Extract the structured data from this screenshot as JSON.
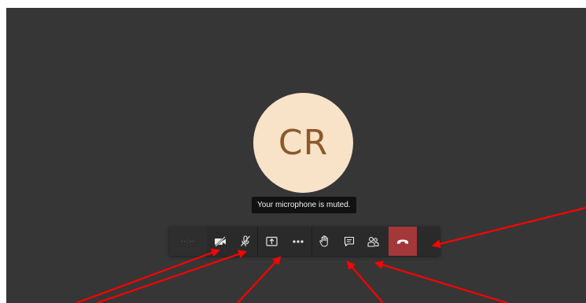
{
  "participant": {
    "initials": "CR"
  },
  "tooltip": {
    "text": "Your microphone is muted."
  },
  "toolbar": {
    "timer_text": "--:--",
    "buttons": [
      {
        "name": "camera-off",
        "icon": "video-off-icon"
      },
      {
        "name": "mic-muted",
        "icon": "mic-off-icon"
      },
      {
        "name": "share-screen",
        "icon": "share-tray-icon"
      },
      {
        "name": "more-actions",
        "icon": "more-horizontal-icon"
      },
      {
        "name": "raise-hand",
        "icon": "hand-icon"
      },
      {
        "name": "show-conversation",
        "icon": "chat-icon"
      },
      {
        "name": "show-participants",
        "icon": "people-icon"
      },
      {
        "name": "hang-up",
        "icon": "phone-hangup-icon"
      }
    ]
  },
  "colors": {
    "meeting_background": "#363636",
    "toolbar_background": "#2a2a2a",
    "avatar_background": "#f8e2c8",
    "avatar_text": "#8a5a2b",
    "hangup_red": "#a4373a",
    "annotation_arrow": "#ff0000"
  }
}
